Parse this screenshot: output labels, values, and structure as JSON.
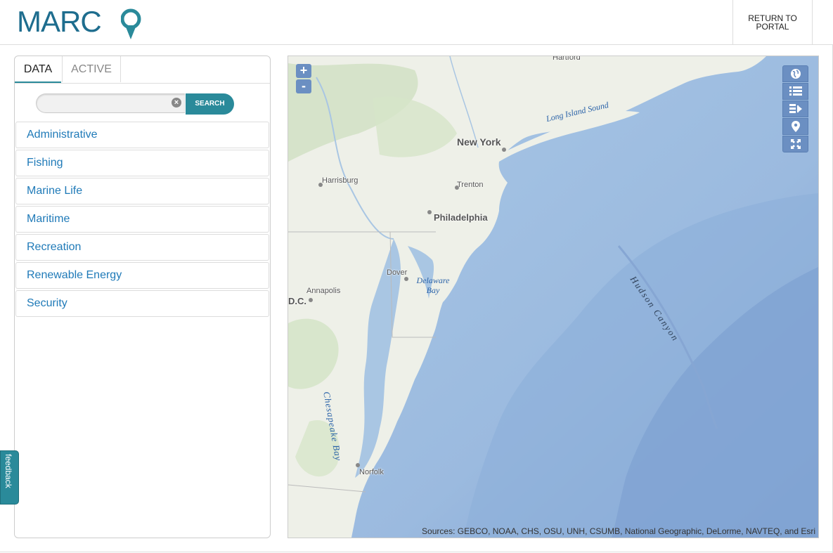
{
  "header": {
    "logo_text": "MARC",
    "return_label": "RETURN TO PORTAL"
  },
  "sidebar": {
    "tabs": [
      {
        "label": "DATA",
        "selected": true
      },
      {
        "label": "ACTIVE",
        "selected": false
      }
    ],
    "search": {
      "value": "",
      "placeholder": "",
      "button_label": "SEARCH"
    },
    "categories": [
      "Administrative",
      "Fishing",
      "Marine Life",
      "Maritime",
      "Recreation",
      "Renewable Energy",
      "Security"
    ]
  },
  "feedback_label": "feedback",
  "map": {
    "zoom_in": "+",
    "zoom_out": "-",
    "tools": [
      "globe-icon",
      "list-icon",
      "layers-add-icon",
      "map-pin-icon",
      "fullscreen-icon"
    ],
    "labels": {
      "hartford": "Hartford",
      "long_island_sound": "Long Island Sound",
      "new_york": "New York",
      "harrisburg": "Harrisburg",
      "trenton": "Trenton",
      "philadelphia": "Philadelphia",
      "dover": "Dover",
      "delaware_bay": "Delaware Bay",
      "annapolis": "Annapolis",
      "dc": "D.C.",
      "chesapeake_bay": "Chesapeake Bay",
      "norfolk": "Norfolk",
      "hudson_canyon": "Hudson Canyon"
    },
    "attribution": "Sources: GEBCO, NOAA, CHS, OSU, UNH, CSUMB, National Geographic, DeLorme, NAVTEQ, and Esri"
  },
  "colors": {
    "brand": "#1e6d8e",
    "accent": "#2a8a9a",
    "link": "#1f7ab8",
    "map_control": "#6b8fc2"
  }
}
